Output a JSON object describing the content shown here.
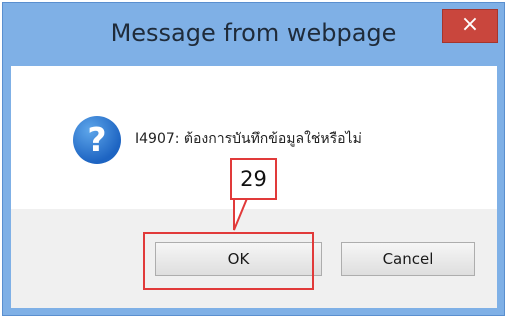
{
  "dialog": {
    "title": "Message from webpage",
    "close_symbol": "×",
    "icon": "question-icon",
    "message": "I4907: ต้องการบันทึกข้อมูลใช่หรือไม่",
    "ok_label": "OK",
    "cancel_label": "Cancel"
  },
  "annotation": {
    "number": "29",
    "color": "#e13a3a"
  }
}
